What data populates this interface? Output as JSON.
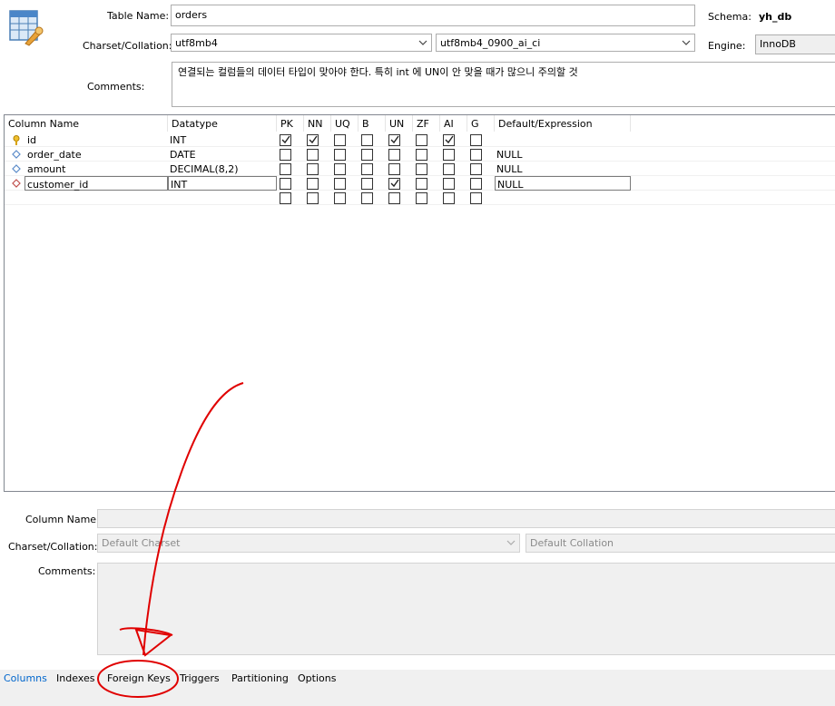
{
  "header": {
    "table_name_label": "Table Name:",
    "table_name_value": "orders",
    "schema_label": "Schema:",
    "schema_value": "yh_db",
    "charset_label": "Charset/Collation:",
    "charset_value": "utf8mb4",
    "collation_value": "utf8mb4_0900_ai_ci",
    "engine_label": "Engine:",
    "engine_value": "InnoDB",
    "comments_label": "Comments:",
    "comments_value": "연결되는 컬럼들의 데이터 타입이 맞아야 한다. 특히 int 에 UN이 안 맞을 때가 많으니 주의할 것"
  },
  "grid": {
    "headers": [
      "Column Name",
      "Datatype",
      "PK",
      "NN",
      "UQ",
      "B",
      "UN",
      "ZF",
      "AI",
      "G",
      "Default/Expression"
    ],
    "rows": [
      {
        "icon": "key-icon",
        "name": "id",
        "datatype": "INT",
        "flags": [
          true,
          true,
          false,
          false,
          true,
          false,
          true,
          false
        ],
        "default": ""
      },
      {
        "icon": "diamond-icon",
        "name": "order_date",
        "datatype": "DATE",
        "flags": [
          false,
          false,
          false,
          false,
          false,
          false,
          false,
          false
        ],
        "default": "NULL"
      },
      {
        "icon": "diamond-icon",
        "name": "amount",
        "datatype": "DECIMAL(8,2)",
        "flags": [
          false,
          false,
          false,
          false,
          false,
          false,
          false,
          false
        ],
        "default": "NULL"
      },
      {
        "icon": "diamond-red-icon",
        "name": "customer_id",
        "datatype": "INT",
        "flags": [
          false,
          false,
          false,
          false,
          true,
          false,
          false,
          false
        ],
        "default": "NULL",
        "editing": true
      },
      {
        "icon": "",
        "name": "",
        "datatype": "",
        "flags": [
          false,
          false,
          false,
          false,
          false,
          false,
          false,
          false
        ],
        "default": ""
      }
    ]
  },
  "details": {
    "column_name_label": "Column Name:",
    "column_name_value": "",
    "charset_label": "Charset/Collation:",
    "charset_value": "Default Charset",
    "collation_value": "Default Collation",
    "comments_label": "Comments:"
  },
  "tabs": [
    "Columns",
    "Indexes",
    "Foreign Keys",
    "Triggers",
    "Partitioning",
    "Options"
  ],
  "colors": {
    "active_tab": "#0066cc",
    "annotation": "#e00000"
  }
}
